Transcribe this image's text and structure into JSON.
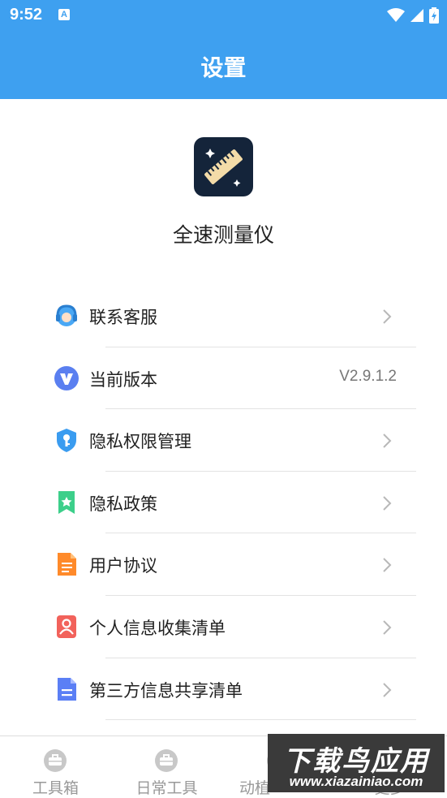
{
  "status_bar": {
    "time": "9:52",
    "notification_letter": "A"
  },
  "header": {
    "title": "设置"
  },
  "app": {
    "name": "全速测量仪"
  },
  "settings": {
    "items": [
      {
        "label": "联系客服",
        "icon": "customer-service-icon",
        "value": ""
      },
      {
        "label": "当前版本",
        "icon": "version-icon",
        "value": "V2.9.1.2"
      },
      {
        "label": "隐私权限管理",
        "icon": "privacy-permission-icon",
        "value": ""
      },
      {
        "label": "隐私政策",
        "icon": "privacy-policy-icon",
        "value": ""
      },
      {
        "label": "用户协议",
        "icon": "user-agreement-icon",
        "value": ""
      },
      {
        "label": "个人信息收集清单",
        "icon": "personal-info-icon",
        "value": ""
      },
      {
        "label": "第三方信息共享清单",
        "icon": "third-party-sharing-icon",
        "value": ""
      }
    ]
  },
  "tabbar": {
    "tabs": [
      {
        "label": "工具箱",
        "icon": "toolbox-icon"
      },
      {
        "label": "日常工具",
        "icon": "toolbox-icon"
      },
      {
        "label": "动植",
        "icon": "toolbox-icon"
      },
      {
        "label": "更多",
        "icon": "toolbox-icon"
      }
    ]
  },
  "watermark": {
    "title": "下载鸟应用",
    "url": "www.xiazainiao.com"
  },
  "colors": {
    "primary": "#3ea0f0",
    "divider": "#e3e3e3",
    "text": "#222222",
    "muted": "#999999"
  }
}
